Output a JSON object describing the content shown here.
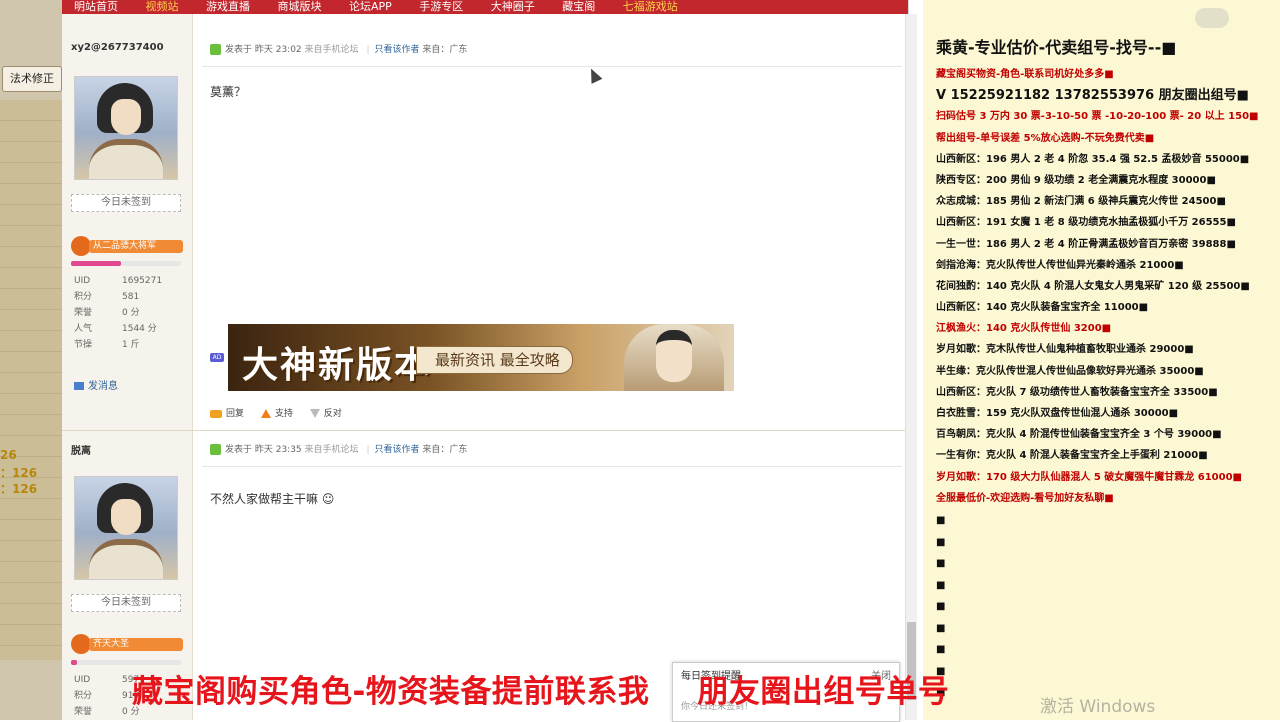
{
  "left_strip": {
    "tab_label": "法术修正",
    "stat_1": "26",
    "stat_2": "：126",
    "stat_3": "：126"
  },
  "forum": {
    "topnav": [
      "明站首页",
      "视频站",
      "游戏直播",
      "商城版块",
      "论坛APP",
      "手游专区",
      "大神圈子",
      "藏宝阁",
      "七福游戏站"
    ],
    "posts": [
      {
        "username": "xy2@267737400",
        "checkin": "今日未签到",
        "rank": "从二品骠大将军",
        "progress_fraction": 0.45,
        "stats": [
          {
            "k": "UID",
            "v": "1695271"
          },
          {
            "k": "积分",
            "v": "581"
          },
          {
            "k": "荣誉",
            "v": "0 分"
          },
          {
            "k": "人气",
            "v": "1544 分"
          },
          {
            "k": "节操",
            "v": "1 斤"
          }
        ],
        "send_message": "发消息",
        "meta_posted": "发表于 昨天 23:02",
        "meta_source": "来自手机论坛",
        "meta_only_author": "只看该作者",
        "meta_location": "来自：广东",
        "text": "莫薰？",
        "actions": {
          "reply": "回复",
          "support": "支持",
          "oppose": "反对"
        }
      },
      {
        "username": "脱离",
        "checkin": "今日未签到",
        "rank": "齐天大圣",
        "progress_fraction": 0.05,
        "stats": [
          {
            "k": "UID",
            "v": "597"
          },
          {
            "k": "积分",
            "v": "910"
          },
          {
            "k": "荣誉",
            "v": "0 分"
          }
        ],
        "meta_posted": "发表于 昨天 23:35",
        "meta_source": "来自手机论坛",
        "meta_only_author": "只看该作者",
        "meta_location": "来自：广东",
        "text": "不然人家做帮主干嘛 ☺"
      }
    ],
    "banner": {
      "big_text": "大神新版本",
      "small_text": "最新资讯  最全攻略",
      "ad_tag": "AD"
    },
    "popup": {
      "title": "每日签到提醒",
      "close": "关闭",
      "body": "你今日还未签到！"
    }
  },
  "sidebar": {
    "headline": "乘黄-专业估价-代卖组号-找号--■",
    "lines": [
      {
        "text": "藏宝阁买物资-角色-联系司机好处多多■",
        "style": "red"
      },
      {
        "text": "V 15225921182   13782553976 朋友圈出组号■",
        "style": "big"
      },
      {
        "text": "扫码估号 3 万内 30 票-3-10-50 票  -10-20-100 票- 20 以上 150■",
        "style": "red"
      },
      {
        "text": "帮出组号-单号误差 5%放心选购-不玩免费代卖■",
        "style": "red"
      },
      {
        "text": "山西新区：196 男人 2 老 4 阶忽 35.4 强 52.5 孟极妙音 55000■",
        "style": ""
      },
      {
        "text": "陕西专区：200 男仙 9 级功绩 2 老全满震克水程度 30000■",
        "style": ""
      },
      {
        "text": "众志成城：185 男仙 2 新法门满 6 级神兵震克火传世 24500■",
        "style": ""
      },
      {
        "text": "山西新区：191 女魔 1 老 8 级功绩克水抽孟极狐小千万 26555■",
        "style": ""
      },
      {
        "text": "一生一世：186 男人 2 老 4 阶正骨满孟极妙音百万亲密 39888■",
        "style": ""
      },
      {
        "text": "剑指沧海：克火队传世人传世仙异光秦岭通杀 21000■",
        "style": ""
      },
      {
        "text": "花间独酌：140 克火队 4 阶混人女鬼女人男鬼采矿 120 级 25500■",
        "style": ""
      },
      {
        "text": "山西新区：140 克火队装备宝宝齐全 11000■",
        "style": ""
      },
      {
        "text": "江枫渔火：140 克火队传世仙 3200■",
        "style": "red"
      },
      {
        "text": "岁月如歌：克木队传世人仙鬼种植畜牧职业通杀 29000■",
        "style": ""
      },
      {
        "text": "半生缘：克火队传世混人传世仙品像软好异光通杀 35000■",
        "style": ""
      },
      {
        "text": "山西新区：克火队 7 级功绩传世人畜牧装备宝宝齐全 33500■",
        "style": ""
      },
      {
        "text": "白衣胜雪：159 克火队双盘传世仙混人通杀 30000■",
        "style": ""
      },
      {
        "text": "百鸟朝凤：克火队 4 阶混传世仙装备宝宝齐全 3 个号 39000■",
        "style": ""
      },
      {
        "text": "一生有你：克火队 4 阶混人装备宝宝齐全上手蛋利 21000■",
        "style": ""
      },
      {
        "text": "岁月如歌：170 级大力队仙器混人 5 破女魔强牛魔甘霖龙 61000■",
        "style": "red"
      },
      {
        "text": "全服最低价-欢迎选购-看号加好友私聊■",
        "style": "red"
      }
    ],
    "bullet_count": 9,
    "bullet": "■"
  },
  "overlay": {
    "caption_left": "藏宝阁购买角色-物资装备提前联系我",
    "caption_right": "朋友圈出组号单号",
    "watermark": "激活 Windows"
  },
  "colors": {
    "nav_red": "#c1272d",
    "sidebar_bg": "#fcf8d4",
    "caption_red": "#e6151c"
  }
}
